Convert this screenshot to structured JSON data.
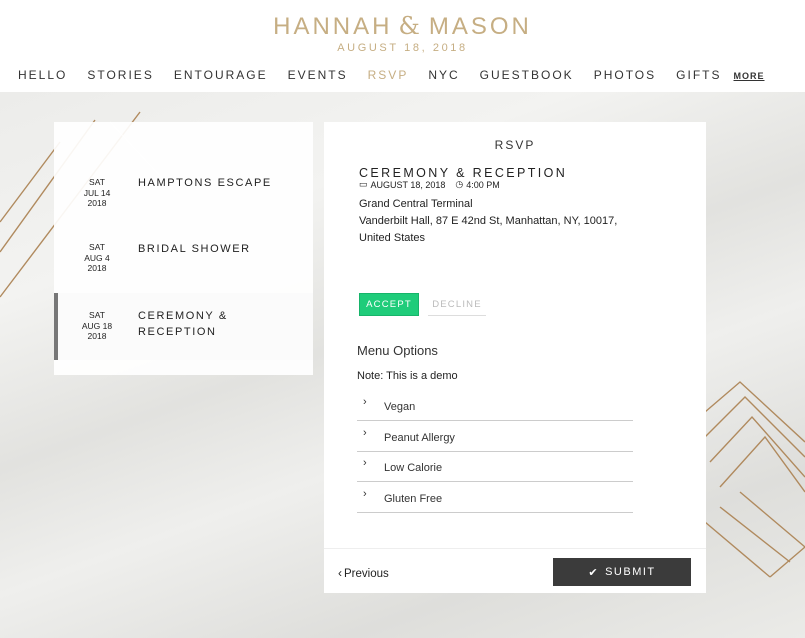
{
  "brand": {
    "first": "HANNAH",
    "amp": "&",
    "second": "MASON",
    "date": "AUGUST 18, 2018"
  },
  "nav": [
    "HELLO",
    "STORIES",
    "ENTOURAGE",
    "EVENTS",
    "RSVP",
    "NYC",
    "GUESTBOOK",
    "PHOTOS",
    "GIFTS"
  ],
  "nav_more": "MORE",
  "nav_active": "RSVP",
  "events": [
    {
      "dow": "SAT",
      "date": "JUL 14",
      "year": "2018",
      "name": "HAMPTONS ESCAPE"
    },
    {
      "dow": "SAT",
      "date": "AUG 4",
      "year": "2018",
      "name": "BRIDAL SHOWER"
    },
    {
      "dow": "SAT",
      "date": "AUG 18",
      "year": "2018",
      "name_line1": "CEREMONY &",
      "name_line2": "RECEPTION"
    }
  ],
  "panel": {
    "title": "RSVP",
    "event_title": "CEREMONY & RECEPTION",
    "date": "AUGUST 18, 2018",
    "time": "4:00 PM",
    "venue": "Grand Central Terminal",
    "address_line1": "Vanderbilt Hall, 87 E 42nd St, Manhattan, NY, 10017,",
    "address_line2": "United States",
    "accept": "ACCEPT",
    "decline": "DECLINE",
    "menu_title": "Menu Options",
    "note": "Note: This is a demo",
    "options": [
      "Vegan",
      "Peanut Allergy",
      "Low Calorie",
      "Gluten Free"
    ],
    "previous": "Previous",
    "submit": "SUBMIT"
  },
  "colors": {
    "gold": "#c6ae83",
    "accept": "#1fcc7a",
    "submit": "#3b3b3b"
  },
  "icons": {
    "calendar": "calendar-icon",
    "clock": "clock-icon",
    "check": "check-icon",
    "chevron": "chevron-right-icon"
  }
}
